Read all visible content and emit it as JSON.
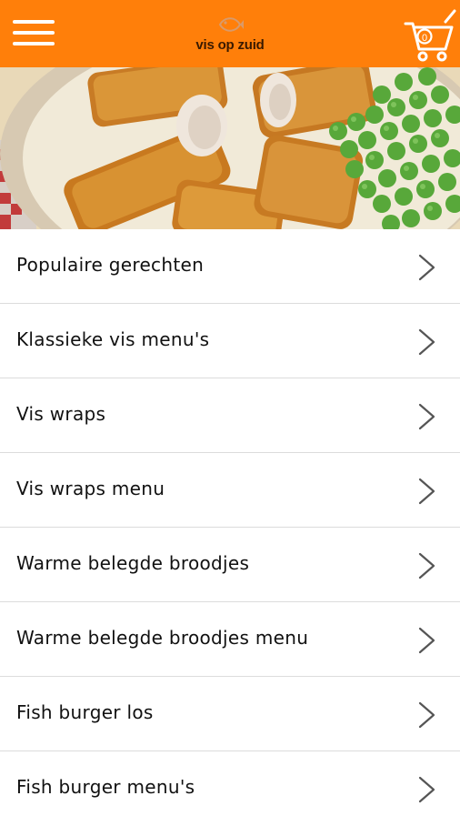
{
  "header": {
    "brand": "vis op zuid",
    "cart_count": "0",
    "background_color": "#ff7f0a",
    "menu_icon": "hamburger-icon",
    "cart_icon": "shopping-cart-icon"
  },
  "hero": {
    "image": "fish-sticks-with-peas-photo"
  },
  "menu": {
    "items": [
      {
        "label": "Populaire gerechten"
      },
      {
        "label": "Klassieke vis menu's"
      },
      {
        "label": "Vis wraps"
      },
      {
        "label": "Vis wraps menu"
      },
      {
        "label": "Warme belegde broodjes"
      },
      {
        "label": "Warme belegde broodjes menu"
      },
      {
        "label": "Fish burger los"
      },
      {
        "label": "Fish burger menu's"
      }
    ],
    "chevron_icon": "chevron-right-icon"
  }
}
